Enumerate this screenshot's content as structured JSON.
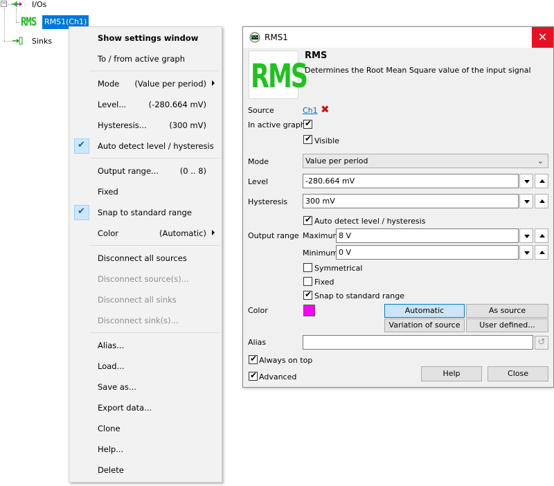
{
  "tree": {
    "root_label": "I/Os",
    "rms_logo": "RMS",
    "selected_item": "RMS1(Ch1)",
    "sinks_label": "Sinks"
  },
  "context_menu": {
    "show_settings": "Show settings window",
    "to_from_graph": "To / from active graph",
    "mode_label": "Mode",
    "mode_value": "(Value per period)",
    "level_label": "Level...",
    "level_value": "(-280.664 mV)",
    "hysteresis_label": "Hysteresis...",
    "hysteresis_value": "(300 mV)",
    "auto_detect": "Auto detect level / hysteresis",
    "output_range_label": "Output range...",
    "output_range_value": "(0 .. 8)",
    "fixed": "Fixed",
    "snap": "Snap to standard range",
    "color_label": "Color",
    "color_value": "(Automatic)",
    "disconnect_all_sources": "Disconnect all sources",
    "disconnect_sources": "Disconnect source(s)...",
    "disconnect_all_sinks": "Disconnect all sinks",
    "disconnect_sinks": "Disconnect sink(s)...",
    "alias": "Alias...",
    "load": "Load...",
    "save_as": "Save as...",
    "export_data": "Export data...",
    "clone": "Clone",
    "help": "Help...",
    "delete": "Delete",
    "checked": {
      "auto_detect": true,
      "snap": true
    }
  },
  "dialog": {
    "title": "RMS1",
    "logo_text": "RMS",
    "heading": "RMS",
    "description": "Determines the Root Mean Square value of the input signal",
    "source_label": "Source",
    "source_link": "Ch1",
    "in_active_graph_label": "In active graph",
    "visible_label": "Visible",
    "mode_label": "Mode",
    "mode_value": "Value per period",
    "level_label": "Level",
    "level_value": "-280.664 mV",
    "hysteresis_label": "Hysteresis",
    "hysteresis_value": "300 mV",
    "auto_detect_label": "Auto detect level / hysteresis",
    "output_range_label": "Output range",
    "maximum_label": "Maximum",
    "maximum_value": "8 V",
    "minimum_label": "Minimum",
    "minimum_value": "0 V",
    "symmetrical_label": "Symmetrical",
    "fixed_label": "Fixed",
    "snap_label": "Snap to standard range",
    "color_label": "Color",
    "color_swatch": "#ff00ff",
    "btn_automatic": "Automatic",
    "btn_as_source": "As source",
    "btn_variation": "Variation of source",
    "btn_user_defined": "User defined...",
    "alias_label": "Alias",
    "alias_value": "",
    "always_on_top_label": "Always on top",
    "advanced_label": "Advanced",
    "help_button": "Help",
    "close_button": "Close",
    "checks": {
      "in_active_graph": true,
      "visible": true,
      "auto_detect": true,
      "symmetrical": false,
      "fixed": false,
      "snap": true,
      "always_on_top": true,
      "advanced": true
    }
  },
  "colors": {
    "accent": "#0078d7",
    "close_red": "#e81123",
    "rms_green": "#1fc21f",
    "link": "#0066cc"
  },
  "icons": {
    "tree_io": "io-arrows-icon",
    "tree_sinks": "sink-arrow-icon",
    "dialog_title": "oscilloscope-icon",
    "close": "close-icon",
    "disconnect": "red-x-icon",
    "check": "check-icon",
    "dropdown": "chevron-down-icon",
    "spin_up": "triangle-up-icon",
    "spin_down": "triangle-down-icon",
    "reset": "undo-icon"
  }
}
